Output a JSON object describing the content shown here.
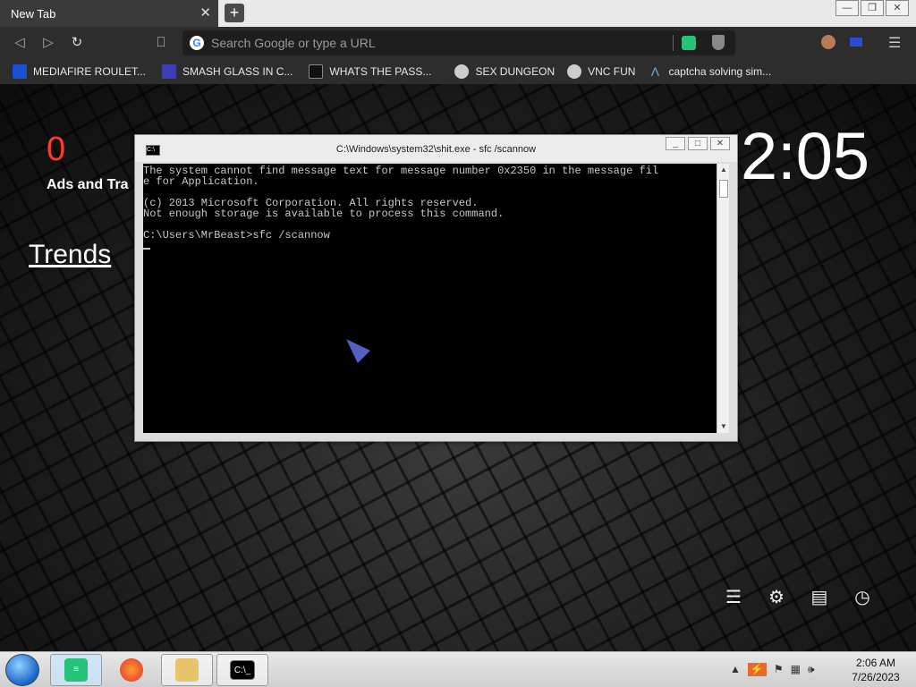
{
  "browser": {
    "tab_title": "New Tab",
    "tab_close": "✕",
    "new_tab": "+",
    "window_controls": [
      "—",
      "❐",
      "✕"
    ],
    "omnibox_placeholder": "Search Google or type a URL",
    "menu": "☰"
  },
  "bookmarks": [
    {
      "label": "MEDIAFIRE ROULET...",
      "icon": "mediafire-icon"
    },
    {
      "label": "SMASH GLASS IN C...",
      "icon": "smash-icon"
    },
    {
      "label": "WHATS THE PASS...",
      "icon": "lock-icon"
    },
    {
      "label": "SEX DUNGEON",
      "icon": "ghost-icon"
    },
    {
      "label": "VNC FUN",
      "icon": "ghost-icon"
    },
    {
      "label": "captcha solving sim...",
      "icon": "lambda-icon"
    }
  ],
  "ntp": {
    "counter": "0",
    "ads_label": "Ads and Tra",
    "trends": "Trends",
    "clock": "2:05",
    "icons": [
      "sliders-icon",
      "gear-icon",
      "bookmark-icon",
      "history-icon"
    ]
  },
  "console": {
    "title": "C:\\Windows\\system32\\shit.exe - sfc  /scannow",
    "controls": [
      "_",
      "□",
      "✕"
    ],
    "lines": [
      "The system cannot find message text for message number 0x2350 in the message fil",
      "e for Application.",
      "",
      "(c) 2013 Microsoft Corporation. All rights reserved.",
      "Not enough storage is available to process this command.",
      "",
      "C:\\Users\\MrBeast>sfc /scannow"
    ]
  },
  "taskbar": {
    "items": [
      "notes-app",
      "firefox",
      "file-explorer",
      "command-prompt"
    ],
    "time": "2:06 AM",
    "date": "7/26/2023"
  }
}
